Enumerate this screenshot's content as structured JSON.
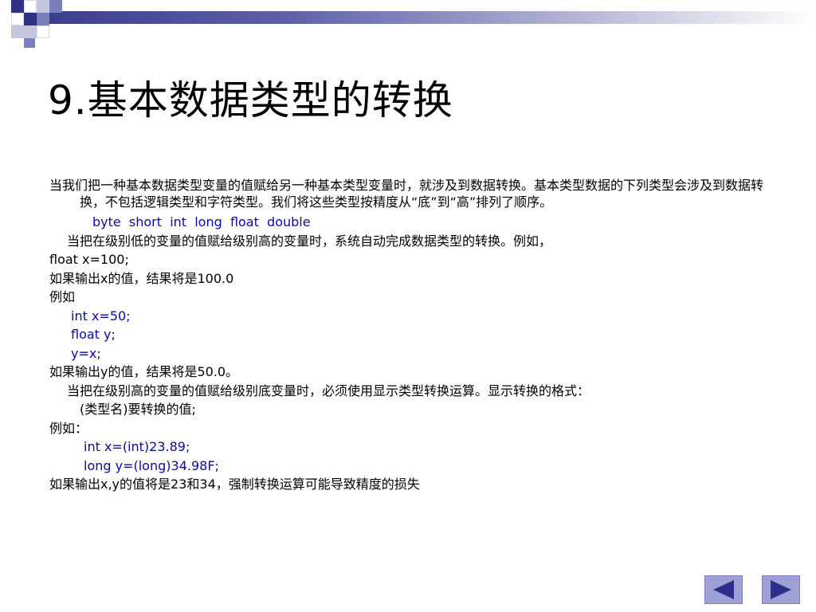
{
  "slide": {
    "title": "9.基本数据类型的转换",
    "paragraph_intro": "当我们把一种基本数据类型变量的值赋给另一种基本类型变量时，就涉及到数据转换。基本类型数据的下列类型会涉及到数据转换，不包括逻辑类型和字符类型。我们将这些类型按精度从“底”到“高”排列了顺序。",
    "type_order": "byte  short  int  long  float  double",
    "low_to_high_note": "当把在级别低的变量的值赋给级别高的变量时，系统自动完成数据类型的转换。例如，",
    "example1_code": "float x=100;",
    "example1_result": "如果输出x的值，结果将是100.0",
    "example_label_1": "例如",
    "example2_code": [
      "int x=50;",
      "float y;",
      "y=x;"
    ],
    "example2_result": "如果输出y的值，结果将是50.0。",
    "high_to_low_note": "当把在级别高的变量的值赋给级别底变量时，必须使用显示类型转换运算。显示转换的格式：",
    "cast_format": "(类型名)要转换的值;",
    "example_label_2": "例如：",
    "example3_code": [
      "int x=(int)23.89;",
      "long y=(long)34.98F;"
    ],
    "example3_result": "如果输出x,y的值将是23和34，强制转换运算可能导致精度的损失"
  },
  "navigation": {
    "prev_icon": "left-triangle-icon",
    "next_icon": "right-triangle-icon"
  },
  "colors": {
    "code_text": "#0b0b9e",
    "nav_button": "#9fa0d6",
    "nav_arrow": "#2d2f8a",
    "brand_dark": "#2f3383"
  }
}
